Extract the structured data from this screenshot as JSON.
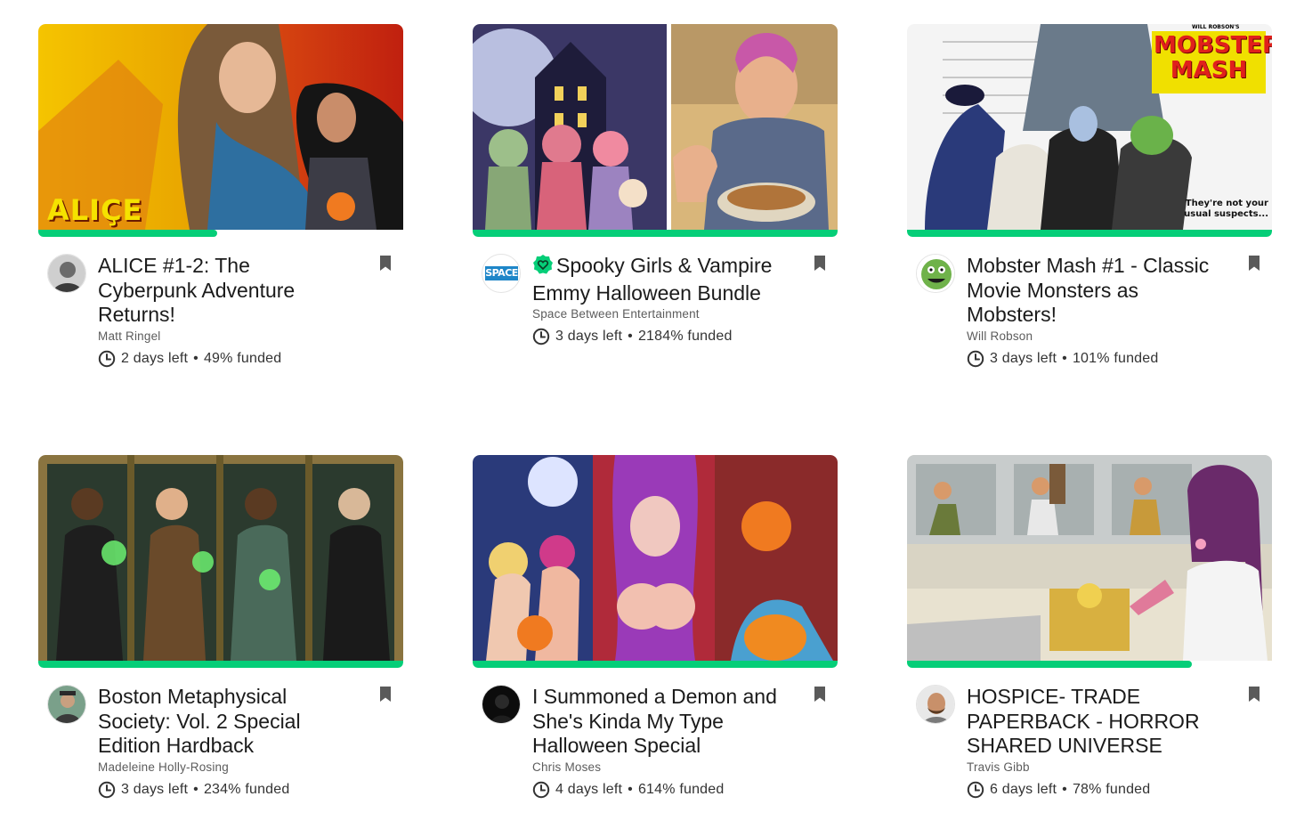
{
  "colors": {
    "accent": "#05ce78",
    "title": "#1b1b1b",
    "secondary": "#5c5c5c"
  },
  "icons": {
    "clock": "clock-icon",
    "bookmark": "bookmark-icon",
    "verified": "verified-heart-icon"
  },
  "projects": [
    {
      "title": "ALICE #1-2: The Cyberpunk Adventure Returns!",
      "creator": "Matt Ringel",
      "days_left": "2 days left",
      "funded": "49% funded",
      "funded_fraction": 0.49,
      "verified": false,
      "cover_text": "ALIÇE"
    },
    {
      "title": "Spooky Girls & Vampire Emmy Halloween Bundle",
      "creator": "Space Between Entertainment",
      "days_left": "3 days left",
      "funded": "2184% funded",
      "funded_fraction": 1.0,
      "verified": true,
      "avatar_text": "SPACE"
    },
    {
      "title": "Mobster Mash #1 - Classic Movie Monsters as Mobsters!",
      "creator": "Will Robson",
      "days_left": "3 days left",
      "funded": "101% funded",
      "funded_fraction": 1.0,
      "verified": false,
      "cover_text": "MOBSTER MASH",
      "cover_subtext": "WILL ROBSON'S",
      "cover_tagline": "They're not your usual suspects..."
    },
    {
      "title": "Boston Metaphysical Society: Vol. 2 Special Edition Hardback",
      "creator": "Madeleine Holly-Rosing",
      "days_left": "3 days left",
      "funded": "234% funded",
      "funded_fraction": 1.0,
      "verified": false
    },
    {
      "title": "I Summoned a Demon and She's Kinda My Type Halloween Special",
      "creator": "Chris Moses",
      "days_left": "4 days left",
      "funded": "614% funded",
      "funded_fraction": 1.0,
      "verified": false
    },
    {
      "title": "HOSPICE- TRADE PAPERBACK - HORROR SHARED UNIVERSE",
      "creator": "Travis Gibb",
      "days_left": "6 days left",
      "funded": "78% funded",
      "funded_fraction": 0.78,
      "verified": false
    }
  ],
  "separator": "•"
}
